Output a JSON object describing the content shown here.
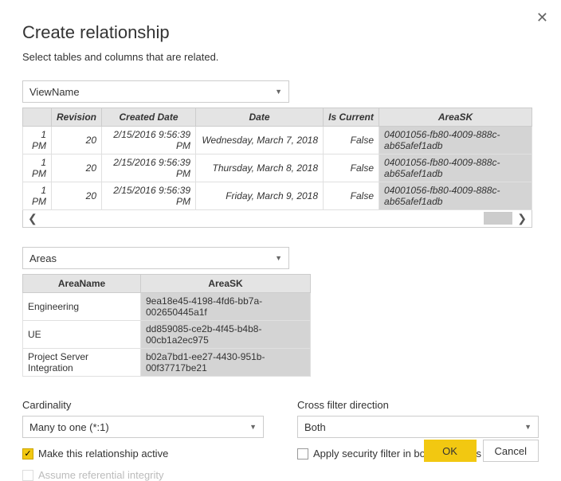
{
  "title": "Create relationship",
  "subtitle": "Select tables and columns that are related.",
  "table1_select": "ViewName",
  "table1": {
    "headers": [
      "",
      "Revision",
      "Created Date",
      "Date",
      "Is Current",
      "AreaSK"
    ],
    "rows": [
      [
        "1 PM",
        "20",
        "2/15/2016 9:56:39 PM",
        "Wednesday, March 7, 2018",
        "False",
        "04001056-fb80-4009-888c-ab65afef1adb"
      ],
      [
        "1 PM",
        "20",
        "2/15/2016 9:56:39 PM",
        "Thursday, March 8, 2018",
        "False",
        "04001056-fb80-4009-888c-ab65afef1adb"
      ],
      [
        "1 PM",
        "20",
        "2/15/2016 9:56:39 PM",
        "Friday, March 9, 2018",
        "False",
        "04001056-fb80-4009-888c-ab65afef1adb"
      ]
    ]
  },
  "table2_select": "Areas",
  "table2": {
    "headers": [
      "AreaName",
      "AreaSK"
    ],
    "rows": [
      [
        "Engineering",
        "9ea18e45-4198-4fd6-bb7a-002650445a1f"
      ],
      [
        "UE",
        "dd859085-ce2b-4f45-b4b8-00cb1a2ec975"
      ],
      [
        "Project Server Integration",
        "b02a7bd1-ee27-4430-951b-00f37717be21"
      ]
    ]
  },
  "cardinality_label": "Cardinality",
  "cardinality_value": "Many to one (*:1)",
  "crossfilter_label": "Cross filter direction",
  "crossfilter_value": "Both",
  "cb_active": "Make this relationship active",
  "cb_integrity": "Assume referential integrity",
  "cb_security": "Apply security filter in both directions",
  "ok": "OK",
  "cancel": "Cancel"
}
